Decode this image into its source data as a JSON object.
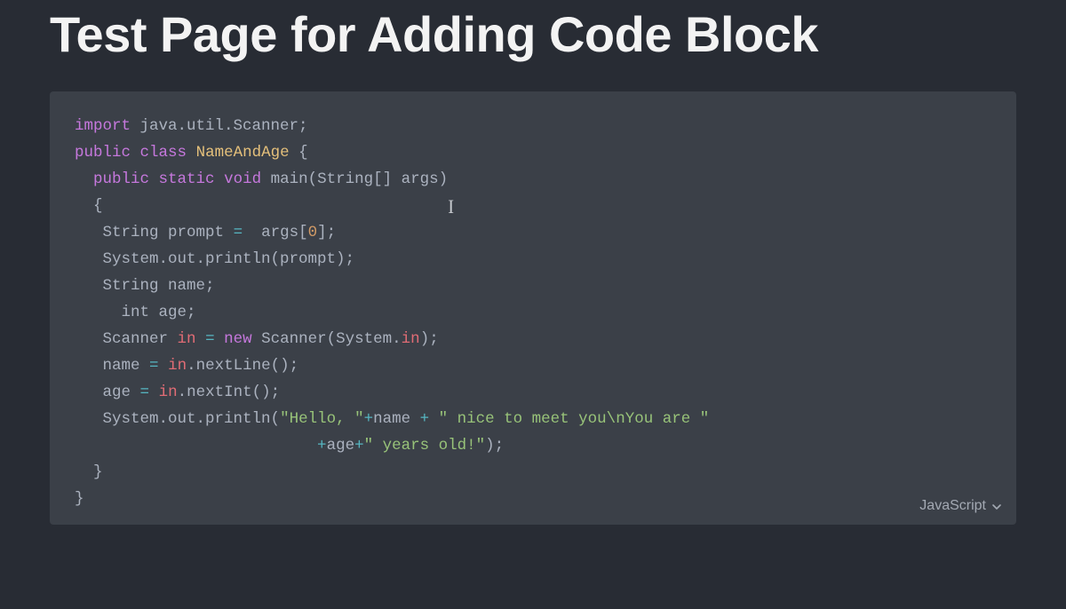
{
  "page": {
    "title": "Test Page for Adding Code Block"
  },
  "codeblock": {
    "language": "JavaScript",
    "code_html": "<span class=\"kw\">import</span> <span class=\"gray\">java.util.Scanner;</span>\n<span class=\"kw\">public</span> <span class=\"kw\">class</span> <span class=\"yel\">NameAndAge</span> <span class=\"gray\">{</span>\n  <span class=\"kw\">public</span> <span class=\"kw\">static</span> <span class=\"kw\">void</span> <span class=\"gray\">main(String[] args)</span>\n  <span class=\"gray\">{</span>\n   <span class=\"gray\">String prompt</span> <span class=\"op\">=</span>  <span class=\"gray\">args[</span><span class=\"num\">0</span><span class=\"gray\">];</span>\n   <span class=\"gray\">System.out.println(prompt);</span>\n   <span class=\"gray\">String name;</span>\n     <span class=\"gray\">int age;</span>\n   <span class=\"gray\">Scanner</span> <span class=\"red\">in</span> <span class=\"op\">=</span> <span class=\"kw\">new</span> <span class=\"gray\">Scanner(System.</span><span class=\"red\">in</span><span class=\"gray\">);</span>\n   <span class=\"gray\">name</span> <span class=\"op\">=</span> <span class=\"red\">in</span><span class=\"gray\">.nextLine();</span>\n   <span class=\"gray\">age</span> <span class=\"op\">=</span> <span class=\"red\">in</span><span class=\"gray\">.nextInt();</span>\n   <span class=\"gray\">System.out.println(</span><span class=\"str\">\"Hello, \"</span><span class=\"op\">+</span><span class=\"gray\">name</span> <span class=\"op\">+</span> <span class=\"str\">\" nice to meet you\\nYou are \"</span>\n                          <span class=\"op\">+</span><span class=\"gray\">age</span><span class=\"op\">+</span><span class=\"str\">\" years old!\"</span><span class=\"gray\">);</span>\n  <span class=\"gray\">}</span>\n<span class=\"gray\">}</span>",
    "code_plain": "import java.util.Scanner;\npublic class NameAndAge {\n  public static void main(String[] args)\n  {\n   String prompt =  args[0];\n   System.out.println(prompt);\n   String name;\n     int age;\n   Scanner in = new Scanner(System.in);\n   name = in.nextLine();\n   age = in.nextInt();\n   System.out.println(\"Hello, \"+name + \" nice to meet you\\nYou are \"\n                          +age+\" years old!\");\n  }\n}"
  }
}
